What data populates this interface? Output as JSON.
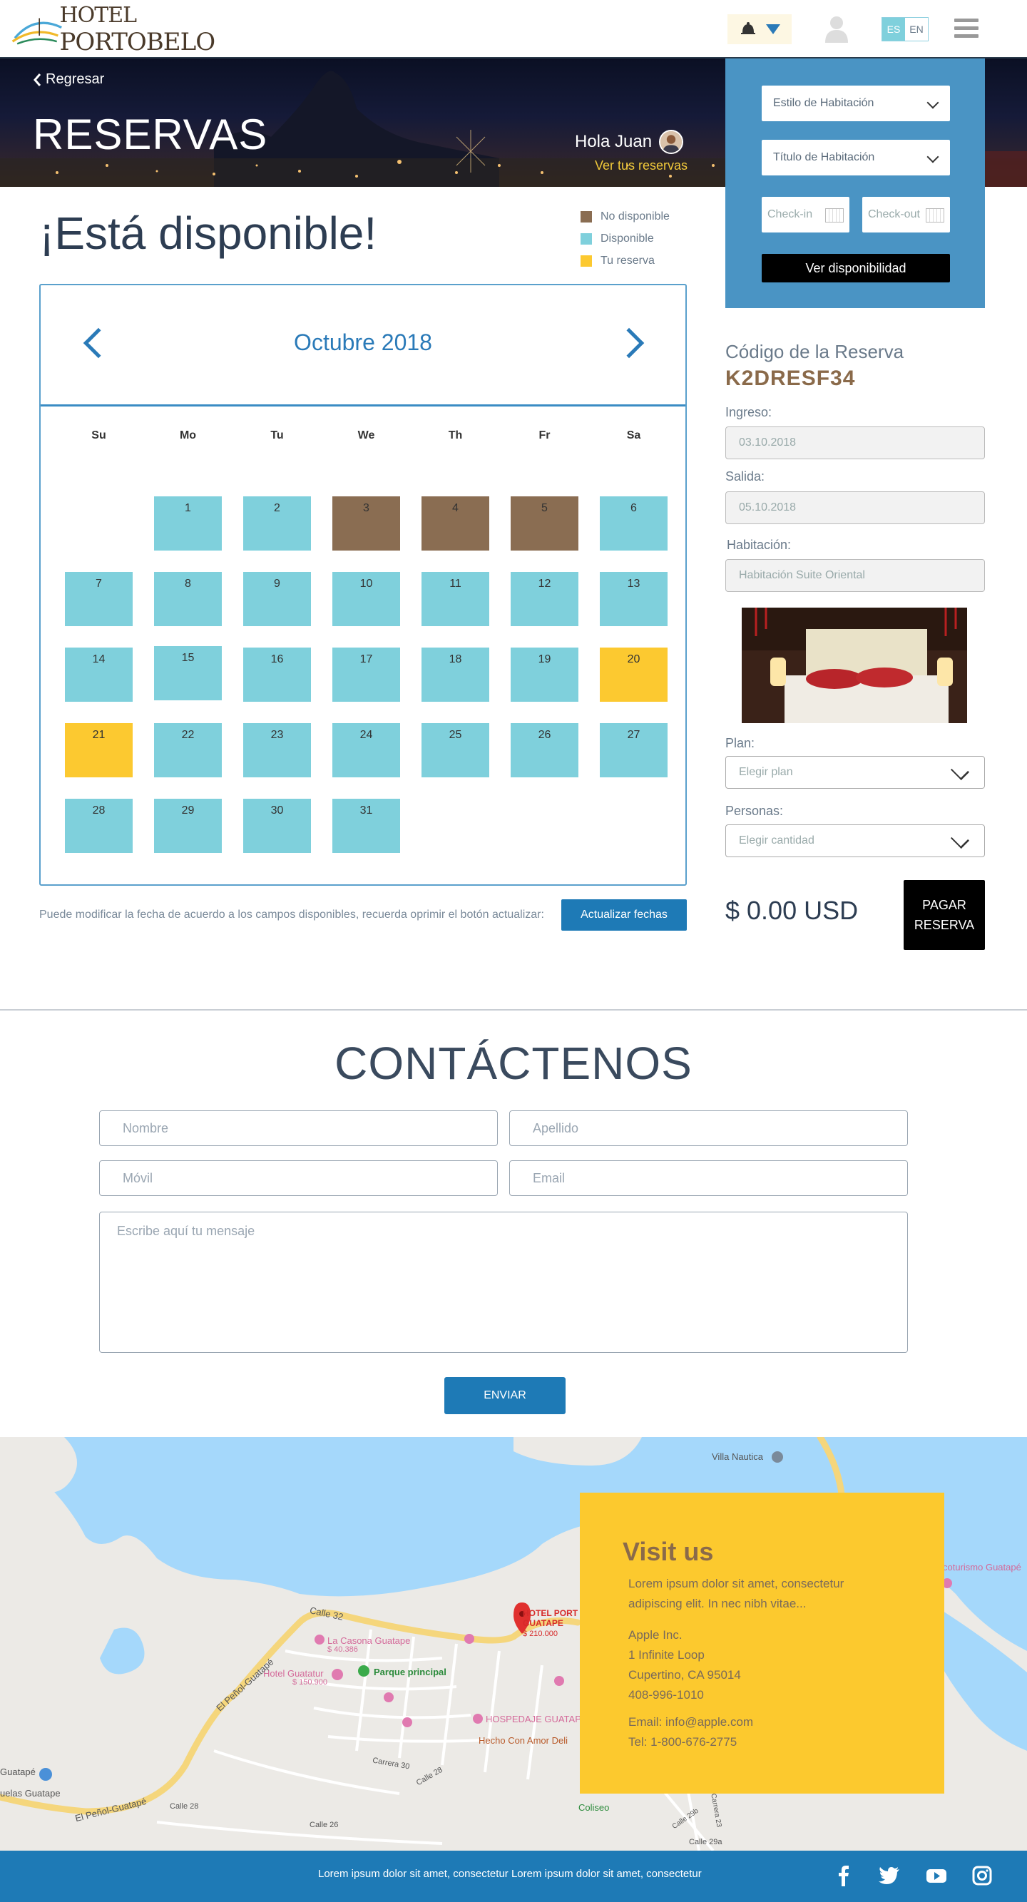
{
  "navbar": {
    "brand_small": "HOTEL",
    "brand_big": "PORTOBELO",
    "lang_active": "ES",
    "lang_inactive": "EN"
  },
  "hero": {
    "back_label": "Regresar",
    "title": "RESERVAS",
    "greeting": "Hola Juan",
    "my_reservations": "Ver tus reservas"
  },
  "search": {
    "room_style_placeholder": "Estilo de Habitación",
    "room_title_placeholder": "Título de Habitación",
    "checkin_placeholder": "Check-in",
    "checkout_placeholder": "Check-out",
    "submit_label": "Ver disponibilidad"
  },
  "availability": {
    "title": "¡Está disponible!",
    "legend": [
      {
        "label": "No disponible",
        "color": "#8a6d52"
      },
      {
        "label": "Disponible",
        "color": "#7fd0dc"
      },
      {
        "label": "Tu reserva",
        "color": "#fcc930"
      }
    ],
    "note": "Puede modificar la fecha de acuerdo a los campos disponibles, recuerda oprimir el botón actualizar:",
    "update_label": "Actualizar fechas"
  },
  "calendar": {
    "month": "Octubre 2018",
    "weekdays": [
      "Su",
      "Mo",
      "Tu",
      "We",
      "Th",
      "Fr",
      "Sa"
    ],
    "first_weekday_index": 1,
    "days": [
      {
        "n": "1",
        "s": "avail"
      },
      {
        "n": "2",
        "s": "avail"
      },
      {
        "n": "3",
        "s": "unavail"
      },
      {
        "n": "4",
        "s": "unavail"
      },
      {
        "n": "5",
        "s": "unavail"
      },
      {
        "n": "6",
        "s": "avail"
      },
      {
        "n": "7",
        "s": "avail"
      },
      {
        "n": "8",
        "s": "avail"
      },
      {
        "n": "9",
        "s": "avail"
      },
      {
        "n": "10",
        "s": "avail"
      },
      {
        "n": "11",
        "s": "avail"
      },
      {
        "n": "12",
        "s": "avail"
      },
      {
        "n": "13",
        "s": "avail"
      },
      {
        "n": "14",
        "s": "avail"
      },
      {
        "n": "15",
        "s": "avail"
      },
      {
        "n": "16",
        "s": "avail"
      },
      {
        "n": "17",
        "s": "avail"
      },
      {
        "n": "18",
        "s": "avail"
      },
      {
        "n": "19",
        "s": "avail"
      },
      {
        "n": "20",
        "s": "mine"
      },
      {
        "n": "21",
        "s": "mine"
      },
      {
        "n": "22",
        "s": "avail"
      },
      {
        "n": "23",
        "s": "avail"
      },
      {
        "n": "24",
        "s": "avail"
      },
      {
        "n": "25",
        "s": "avail"
      },
      {
        "n": "26",
        "s": "avail"
      },
      {
        "n": "27",
        "s": "avail"
      },
      {
        "n": "28",
        "s": "avail"
      },
      {
        "n": "29",
        "s": "avail"
      },
      {
        "n": "30",
        "s": "avail"
      },
      {
        "n": "31",
        "s": "avail"
      }
    ]
  },
  "booking": {
    "code_label": "Código de la Reserva",
    "code": "K2DRESF34",
    "checkin_label": "Ingreso:",
    "checkin_value": "03.10.2018",
    "checkout_label": "Salida:",
    "checkout_value": "05.10.2018",
    "room_label": "Habitación:",
    "room_value": "Habitación Suite Oriental",
    "plan_label": "Plan:",
    "plan_placeholder": "Elegir plan",
    "people_label": "Personas:",
    "people_placeholder": "Elegir cantidad",
    "price": "$ 0.00 USD",
    "pay_line1": "PAGAR",
    "pay_line2": "RESERVA"
  },
  "contact": {
    "title": "CONTÁCTENOS",
    "first_name": "Nombre",
    "last_name": "Apellido",
    "mobile": "Móvil",
    "email": "Email",
    "message": "Escribe aquí tu mensaje",
    "send": "ENVIAR"
  },
  "map": {
    "labels": {
      "villa": "Villa Nautica",
      "ecoturismo": "coturismo Guatapé",
      "calle32": "Calle 32",
      "hotel_name_1": "HOTEL PORT",
      "hotel_name_2": "GUATAPE",
      "hotel_price": "$ 210.000",
      "casona": "La Casona Guatape",
      "casona_price": "$ 40.386",
      "hotel_guatatur": "Hotel Guatatur",
      "guatatur_price": "$ 150.900",
      "parque": "Parque principal",
      "hospedaje": "HOSPEDAJE GUATAPE",
      "hecho": "Hecho Con Amor Deli",
      "penol1": "El Peñol-Guatapé",
      "penol2": "El Peñol-Guatapé",
      "carrera30": "Carrera 30",
      "calle28a": "Calle 28",
      "calle28b": "Calle 28",
      "calle26": "Calle 26",
      "guatape": "Guatapé",
      "escuelas": "uelas Guatape",
      "coliseo": "Coliseo",
      "calle29a": "Calle 29a",
      "calle29b": "Calle 29b",
      "carrera23": "Carrera 23"
    }
  },
  "visit": {
    "title": "Visit us",
    "lorem": "Lorem ipsum dolor sit amet, consectetur adipiscing elit. In nec nibh vitae...",
    "company": "Apple Inc.",
    "street": "1 Infinite Loop",
    "city": "Cupertino, CA 95014",
    "phone": "408-996-1010",
    "email": "Email: info@apple.com",
    "tel": "Tel: 1-800-676-2775"
  },
  "footer": {
    "text": "Lorem ipsum dolor sit amet, consectetur Lorem ipsum dolor sit amet, consectetur"
  },
  "colors": {
    "available": "#7fd0dc",
    "unavailable": "#8a6d52",
    "your_booking": "#fcc930",
    "primary_blue": "#1e7ab6",
    "panel_blue": "#4a94c4"
  }
}
